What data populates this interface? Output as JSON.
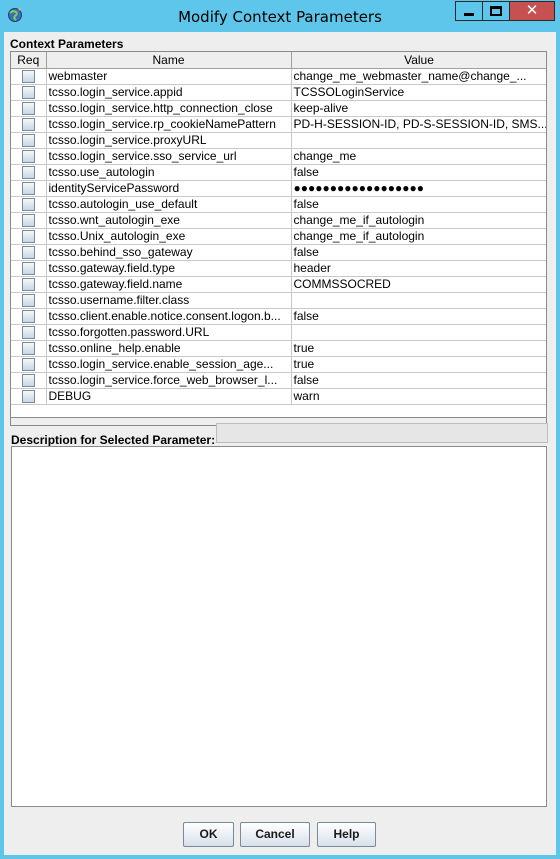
{
  "window": {
    "title": "Modify Context Parameters",
    "close_glyph": "✕",
    "icons": {
      "app": "app-globe-icon",
      "minimize": "minimize-icon",
      "maximize": "maximize-icon",
      "close": "close-icon"
    }
  },
  "section_label": "Context Parameters",
  "table": {
    "columns": [
      "Req",
      "Name",
      "Value"
    ],
    "rows": [
      {
        "name": "webmaster",
        "value": "change_me_webmaster_name@change_..."
      },
      {
        "name": "tcsso.login_service.appid",
        "value": "TCSSOLoginService"
      },
      {
        "name": "tcsso.login_service.http_connection_close",
        "value": "keep-alive"
      },
      {
        "name": "tcsso.login_service.rp_cookieNamePattern",
        "value": "PD-H-SESSION-ID, PD-S-SESSION-ID, SMS..."
      },
      {
        "name": "tcsso.login_service.proxyURL",
        "value": ""
      },
      {
        "name": "tcsso.login_service.sso_service_url",
        "value": "change_me"
      },
      {
        "name": "tcsso.use_autologin",
        "value": "false"
      },
      {
        "name": "identityServicePassword",
        "value": "●●●●●●●●●●●●●●●●●●"
      },
      {
        "name": "tcsso.autologin_use_default",
        "value": "false"
      },
      {
        "name": "tcsso.wnt_autologin_exe",
        "value": "change_me_if_autologin"
      },
      {
        "name": "tcsso.Unix_autologin_exe",
        "value": "change_me_if_autologin"
      },
      {
        "name": "tcsso.behind_sso_gateway",
        "value": "false"
      },
      {
        "name": "tcsso.gateway.field.type",
        "value": "header"
      },
      {
        "name": "tcsso.gateway.field.name",
        "value": "COMMSSOCRED"
      },
      {
        "name": "tcsso.username.filter.class",
        "value": ""
      },
      {
        "name": "tcsso.client.enable.notice.consent.logon.b...",
        "value": "false"
      },
      {
        "name": "tcsso.forgotten.password.URL",
        "value": ""
      },
      {
        "name": "tcsso.online_help.enable",
        "value": "true"
      },
      {
        "name": "tcsso.login_service.enable_session_age...",
        "value": "true"
      },
      {
        "name": "tcsso.login_service.force_web_browser_l...",
        "value": "false"
      },
      {
        "name": "DEBUG",
        "value": "warn"
      }
    ]
  },
  "description": {
    "label": "Description for Selected Parameter:",
    "value": ""
  },
  "buttons": {
    "ok": "OK",
    "cancel": "Cancel",
    "help": "Help"
  },
  "colors": {
    "titlebar": "#5ec6ea",
    "close_button": "#c75050",
    "dialog_bg": "#eeeeee"
  }
}
